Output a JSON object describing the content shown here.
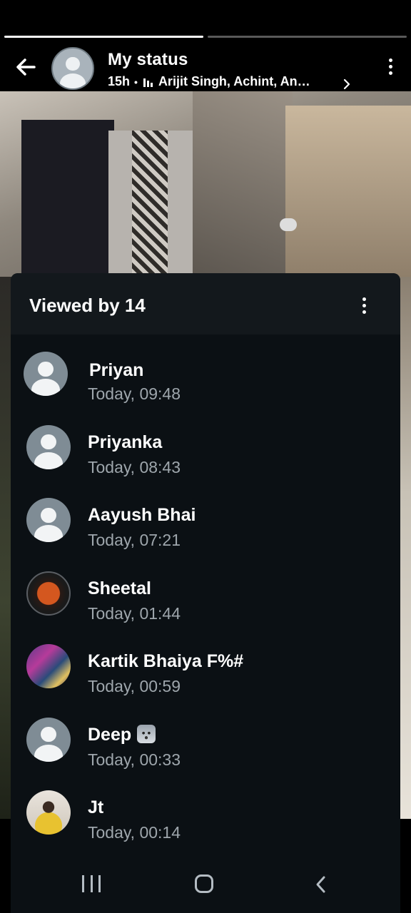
{
  "story": {
    "segments": [
      {
        "state": "done"
      },
      {
        "state": "pending"
      }
    ]
  },
  "header": {
    "title": "My status",
    "age": "15h",
    "dot": "•",
    "names": "Arijit Singh, Achint, An…"
  },
  "viewers": {
    "title": "Viewed by 14",
    "items": [
      {
        "name": "Priyan",
        "time": "Today, 09:48",
        "avatar": "default"
      },
      {
        "name": "Priyanka",
        "time": "Today, 08:43",
        "avatar": "default"
      },
      {
        "name": "Aayush Bhai",
        "time": "Today, 07:21",
        "avatar": "default"
      },
      {
        "name": "Sheetal",
        "time": "Today, 01:44",
        "avatar": "photo"
      },
      {
        "name": "Kartik Bhaiya F%#",
        "time": "Today, 00:59",
        "avatar": "photo"
      },
      {
        "name": "Deep",
        "time": "Today, 00:33",
        "avatar": "default",
        "emoji": "wolf-face"
      },
      {
        "name": "Jt",
        "time": "Today, 00:14",
        "avatar": "photo"
      }
    ]
  },
  "colors": {
    "panel_bg": "#0b1014",
    "panel_header_bg": "#13181c",
    "secondary_text": "#9ea6ac",
    "default_avatar_bg": "#7f8c95"
  },
  "icons": {
    "back": "arrow-left-icon",
    "more": "more-vertical-icon",
    "chevron": "chevron-right-icon",
    "audio": "audio-bars-icon",
    "nav_recent": "recent-apps-icon",
    "nav_home": "home-icon",
    "nav_back": "nav-back-icon"
  }
}
